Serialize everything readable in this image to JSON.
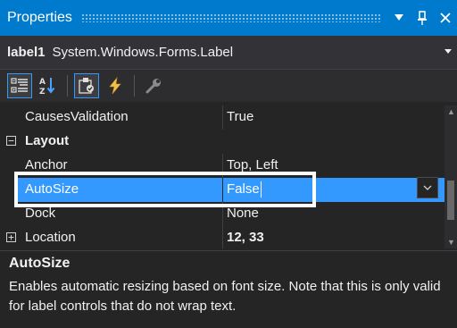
{
  "window": {
    "title": "Properties",
    "pin_glyph": "📌",
    "dropdown_glyph": "▾",
    "close_glyph": "✕"
  },
  "object_selector": {
    "name": "label1",
    "type": "System.Windows.Forms.Label"
  },
  "toolbar": {
    "buttons": [
      {
        "icon": "categorized-icon",
        "active": true
      },
      {
        "icon": "alphabetical-icon",
        "active": false
      },
      {
        "icon": "properties-icon",
        "active": true
      },
      {
        "icon": "events-icon",
        "active": false
      },
      {
        "icon": "property-pages-icon",
        "active": false
      }
    ]
  },
  "properties": {
    "rows": [
      {
        "name": "CausesValidation",
        "value": "True",
        "type": "prop"
      },
      {
        "name": "Layout",
        "value": "",
        "type": "category",
        "expander": "−"
      },
      {
        "name": "Anchor",
        "value": "Top, Left",
        "type": "prop"
      },
      {
        "name": "AutoSize",
        "value": "False",
        "type": "prop",
        "selected": true
      },
      {
        "name": "Dock",
        "value": "None",
        "type": "prop"
      },
      {
        "name": "Location",
        "value": "12, 33",
        "type": "prop",
        "expander": "+",
        "bold_value": true
      }
    ]
  },
  "description": {
    "title": "AutoSize",
    "text": "Enables automatic resizing based on font size. Note that this is only valid for label controls that do not wrap text."
  },
  "colors": {
    "accent": "#007acc",
    "selection": "#3399ff",
    "background": "#252526"
  }
}
